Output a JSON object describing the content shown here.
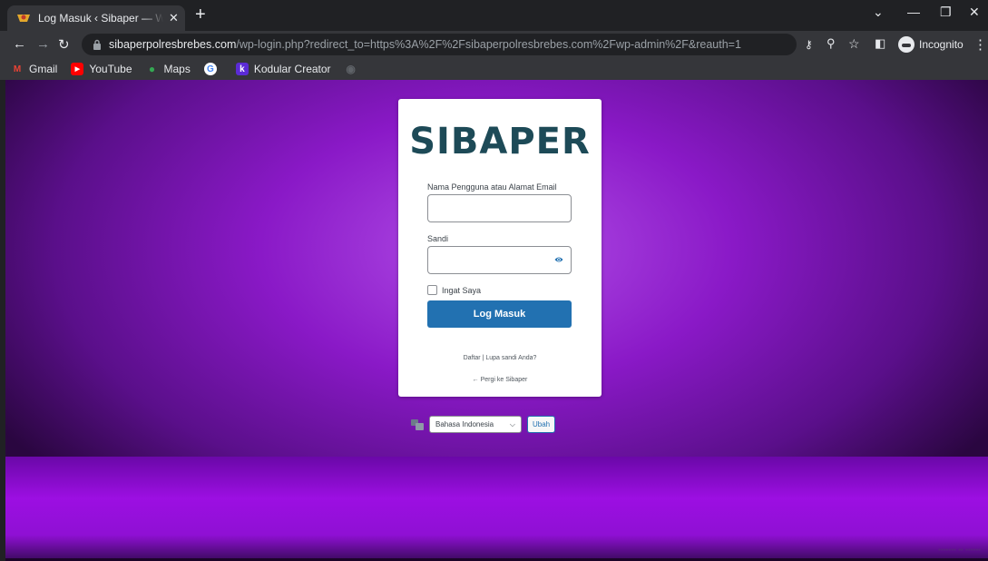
{
  "browser": {
    "tab_title": "Log Masuk ‹ Sibaper — WordPress",
    "close_glyph": "✕",
    "new_tab_glyph": "+",
    "url_host": "sibaperpolresbrebes.com",
    "url_path": "/wp-login.php?redirect_to=https%3A%2F%2Fsibaperpolresbrebes.com%2Fwp-admin%2F&reauth=1",
    "incognito_label": "Incognito",
    "bookmarks": [
      {
        "label": "Gmail",
        "icon": "gmail-icon"
      },
      {
        "label": "YouTube",
        "icon": "youtube-icon"
      },
      {
        "label": "Maps",
        "icon": "maps-icon"
      },
      {
        "label": "",
        "icon": "google-icon"
      },
      {
        "label": "Kodular Creator",
        "icon": "kodular-icon"
      }
    ]
  },
  "login": {
    "logo_text": "SIBAPER",
    "username_label": "Nama Pengguna atau Alamat Email",
    "username_value": "",
    "password_label": "Sandi",
    "password_value": "",
    "remember_label": "Ingat Saya",
    "submit_label": "Log Masuk",
    "register_link": "Daftar",
    "separator": " | ",
    "lost_password_link": "Lupa sandi Anda?",
    "back_link": "← Pergi ke Sibaper"
  },
  "language": {
    "selected": "Bahasa Indonesia",
    "change_button": "Ubah"
  },
  "colors": {
    "accent": "#2271b1",
    "logo": "#1d4a57",
    "background": "#8a19c7"
  }
}
